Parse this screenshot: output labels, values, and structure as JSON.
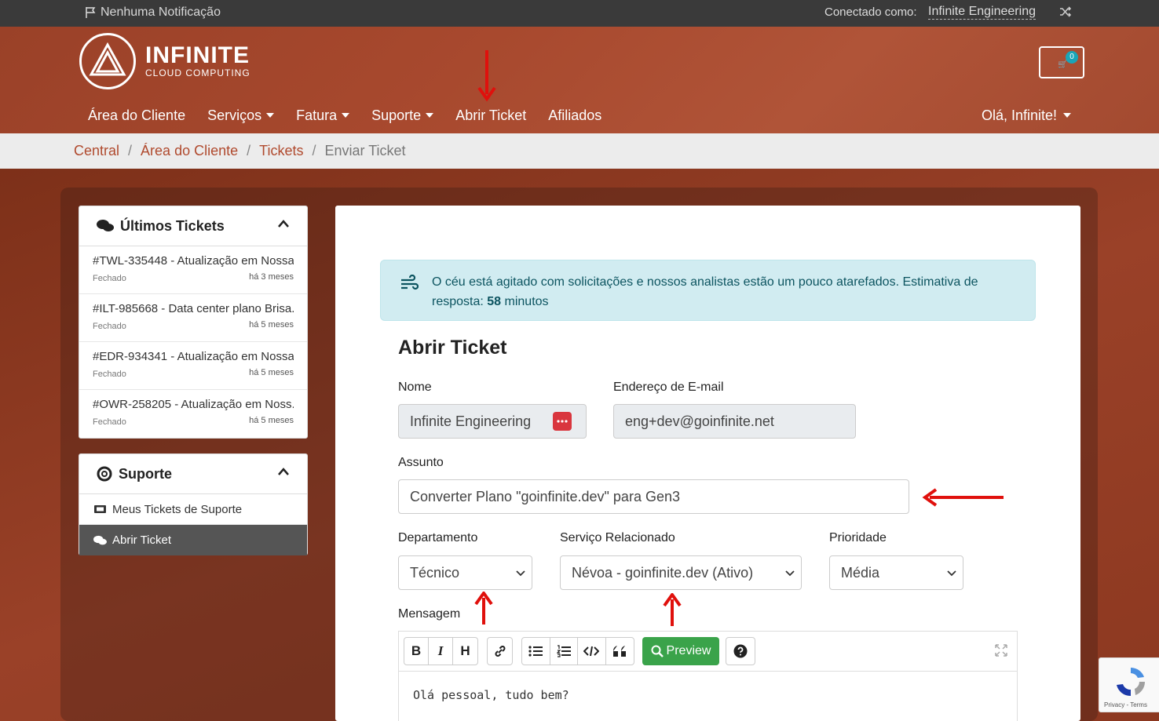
{
  "topbar": {
    "notifications": "Nenhuma Notificação",
    "connected_label": "Conectado como:",
    "user": "Infinite Engineering"
  },
  "header": {
    "logo_big": "INFINITE",
    "logo_small": "CLOUD COMPUTING",
    "cart_count": "0",
    "nav": [
      "Área do Cliente",
      "Serviços",
      "Fatura",
      "Suporte",
      "Abrir Ticket",
      "Afiliados"
    ],
    "greeting": "Olá, Infinite!"
  },
  "breadcrumb": [
    "Central",
    "Área do Cliente",
    "Tickets",
    "Enviar Ticket"
  ],
  "sidebar": {
    "tickets_title": "Últimos Tickets",
    "tickets": [
      {
        "title": "#TWL-335448 - Atualização em Nossa...",
        "status": "Fechado",
        "time": "há 3 meses"
      },
      {
        "title": "#ILT-985668 - Data center plano Brisa...",
        "status": "Fechado",
        "time": "há 5 meses"
      },
      {
        "title": "#EDR-934341 - Atualização em Nossa...",
        "status": "Fechado",
        "time": "há 5 meses"
      },
      {
        "title": "#OWR-258205 - Atualização em Noss...",
        "status": "Fechado",
        "time": "há 5 meses"
      }
    ],
    "support_title": "Suporte",
    "support_items": [
      "Meus Tickets de Suporte",
      "Abrir Ticket"
    ]
  },
  "alert": {
    "text": "O céu está agitado com solicitações e nossos analistas estão um pouco atarefados. Estimativa de resposta:",
    "minutes": "58",
    "minutes_suffix": " minutos"
  },
  "form": {
    "title": "Abrir Ticket",
    "name_label": "Nome",
    "name_value": "Infinite Engineering",
    "email_label": "Endereço de E-mail",
    "email_value": "eng+dev@goinfinite.net",
    "subject_label": "Assunto",
    "subject_value": "Converter Plano \"goinfinite.dev\" para Gen3",
    "department_label": "Departamento",
    "department_value": "Técnico",
    "service_label": "Serviço Relacionado",
    "service_value": "Névoa - goinfinite.dev (Ativo)",
    "priority_label": "Prioridade",
    "priority_value": "Média",
    "message_label": "Mensagem",
    "preview_label": "Preview",
    "message_text": "Olá pessoal, tudo bem?"
  },
  "recaptcha": {
    "label": "Privacy - Terms"
  },
  "colors": {
    "accent": "#b04a2e",
    "success": "#3aa34a",
    "alert_bg": "#d1ecf1",
    "annotation": "#e0100c"
  }
}
